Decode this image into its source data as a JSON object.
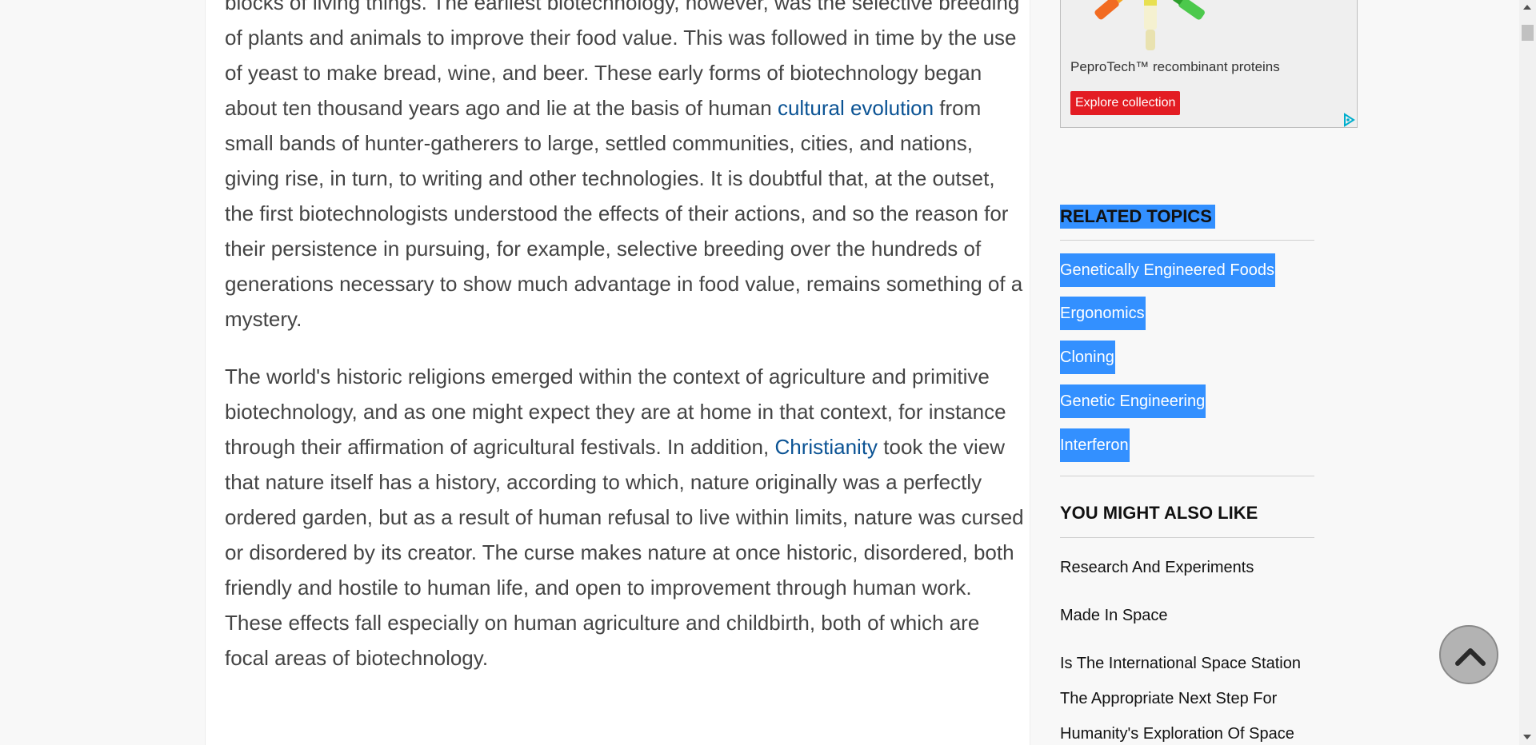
{
  "article": {
    "p1": {
      "a": "blocks of living things. The earliest biotechnology, however, was the selective breeding of plants and animals to improve their food value. This was followed in time by the use of yeast to make bread, wine, and beer. These early forms of biotechnology began about ten thousand years ago and lie at the basis of human ",
      "link": "cultural evolution",
      "b": " from small bands of hunter-gatherers to large, settled communities, cities, and nations, giving rise, in turn, to writing and other technologies. It is doubtful that, at the outset, the first biotechnologists understood the effects of their actions, and so the reason for their persistence in pursuing, for example, selective breeding over the hundreds of generations necessary to show much advantage in food value, remains something of a mystery."
    },
    "p2": {
      "a": "The world's historic religions emerged within the context of agriculture and primitive biotechnology, and as one might expect they are at home in that context, for instance through their affirmation of agricultural festivals. In addition, ",
      "link": "Christianity",
      "b": " took the view that nature itself has a history, according to which, nature originally was a perfectly ordered garden, but as a result of human refusal to live within limits, nature was cursed or disordered by its creator. The curse makes nature at once historic, disordered, both friendly and hostile to human life, and open to improvement through human work. These effects fall especially on human agriculture and childbirth, both of which are focal areas of biotechnology."
    }
  },
  "ad": {
    "caption": "PeproTech™ recombinant proteins",
    "cta": "Explore collection",
    "choices_icon": "adchoices-icon"
  },
  "sidebar": {
    "related_heading": "RELATED TOPICS",
    "related": [
      "Genetically Engineered Foods",
      "Ergonomics",
      "Cloning",
      "Genetic Engineering",
      "Interferon"
    ],
    "also_heading": "YOU MIGHT ALSO LIKE",
    "also": [
      "Research And Experiments",
      "Made In Space",
      "Is The International Space Station The Appropriate Next Step For Humanity's Exploration Of Space"
    ]
  },
  "controls": {
    "back_to_top_icon": "chevron-up-icon"
  },
  "colors": {
    "link": "#0b5394",
    "selection": "#3390ff",
    "ad_cta": "#e31c23",
    "body_text": "#444444"
  }
}
